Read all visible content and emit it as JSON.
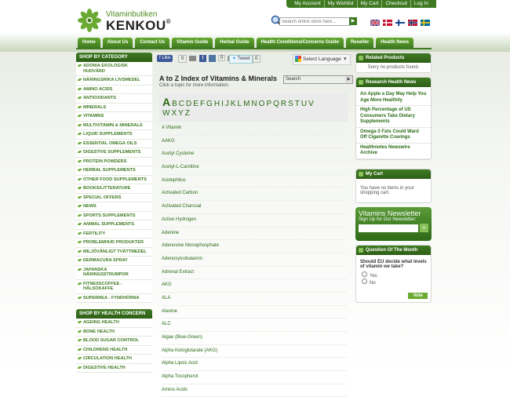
{
  "top_links": [
    "My Account",
    "My Wishlist",
    "My Cart",
    "Checkout",
    "Log In"
  ],
  "logo": {
    "sub": "Vitaminbutiken",
    "main": "KENKOU",
    "reg": "®"
  },
  "search": {
    "placeholder": "Search entire store here..."
  },
  "flags": [
    "uk",
    "dk",
    "fi",
    "no",
    "se"
  ],
  "nav": [
    "Home",
    "About Us",
    "Contact Us",
    "Vitamin Guide",
    "Herbal Guide",
    "Health Conditions/Concerns Guide",
    "Reseller",
    "Health News"
  ],
  "left": {
    "shop_by_category": "SHOP BY CATEGORY",
    "categories": [
      "ADONIA EKOLOGISK HUDVÅRD",
      "NÄRINGSRIKA LIVSMEDEL",
      "AMINO ACIDS",
      "ANTIOXIDANTS",
      "MINERALS",
      "VITAMINS",
      "MULTIVITAMIN & MINERALS",
      "LIQUID SUPPLEMENTS",
      "ESSENTIAL OMEGA OILS",
      "DIGESTIVE SUPPLEMENTS",
      "PROTEIN POWDERS",
      "HERBAL SUPPLEMENTS",
      "OTHER FOOD SUPPLEMENTS",
      "BOOKS/LITTERATURE",
      "SPECIAL OFFERS",
      "NEWS",
      "SPORTS SUPPLEMENTS",
      "ANIMAL SUPPLEMENTS",
      "FERTILITY",
      "PROBLEMHUD PRODUKTER",
      "MILJÖVÄNLIGT TVÄTTMEDEL",
      "DERMACURA SPRAY",
      "JAPANSKA NÄRINGSSTRUMPOR",
      "FITNESSCOFFEE - HÄLSOKAFFE",
      "SUPERREA - FYNDHÖRNA"
    ],
    "shop_by_health": "SHOP BY HEALTH CONCERN",
    "health": [
      "AGEING HEALTH",
      "BONE HEALTH",
      "BLOOD SUGAR CONTROL",
      "CHILDRENS HEALTH",
      "CIRCULATION HEALTH",
      "DIGESTIVE HEALTH"
    ]
  },
  "main": {
    "social": {
      "like": "Like",
      "like_count": "0",
      "tweet": "Tweet",
      "tweet_count": "0",
      "gplus": "0",
      "language": "Select Language"
    },
    "title": "A to Z Index of Vitamins & Minerals",
    "subtitle": "Click a topic for more information.",
    "search_value": "Search",
    "letters_row1": [
      "A",
      "B",
      "C",
      "D",
      "E",
      "F",
      "G",
      "H",
      "I",
      "J",
      "K",
      "L",
      "M",
      "N",
      "O",
      "P",
      "Q",
      "R",
      "S",
      "T",
      "U",
      "V"
    ],
    "letters_row2": [
      "W",
      "X",
      "Y",
      "Z"
    ],
    "items": [
      "A Vitamin",
      "AAKG",
      "Acetyl Cysteine",
      "Acetyl-L-Carnitine",
      "Acidophilus",
      "Activated Carbon",
      "Activated Charcoal",
      "Active Hydrogen",
      "Adenine",
      "Adenosine Monophosphate",
      "Adenosylcobalamin",
      "Adrenal Extract",
      "AKG",
      "ALA",
      "Alanine",
      "ALC",
      "Algae (Blue-Green)",
      "Alpha Ketoglutarate (AKG)",
      "Alpha Lipoic Acid",
      "Alpha Tocopherol",
      "Amino Acids"
    ]
  },
  "right": {
    "related_title": "Related Products",
    "related_body": "Sorry no products found.",
    "news_title": "Research Health News",
    "news": [
      "An Apple a Day May Help You Age More Healthily",
      "High Percentage of US Consumers Take Dietary Supplements",
      "Omega-3 Fats Could Ward Off Cigarette Cravings",
      "Healthnotes Newswire Archive"
    ],
    "cart_title": "My Cart",
    "cart_body": "You have no items in your shopping cart.",
    "newsletter_title": "Vitamins Newsletter",
    "newsletter_sub": "Sign Up for Our Newsletter:",
    "question_title": "Question Of The Month",
    "question": "Should EU decide what levels of vitamin we take?",
    "options": [
      "Yes",
      "No"
    ],
    "vote": "Vote"
  },
  "colors": {
    "brand_green": "#3f7a22",
    "link_green": "#2a6b15"
  }
}
